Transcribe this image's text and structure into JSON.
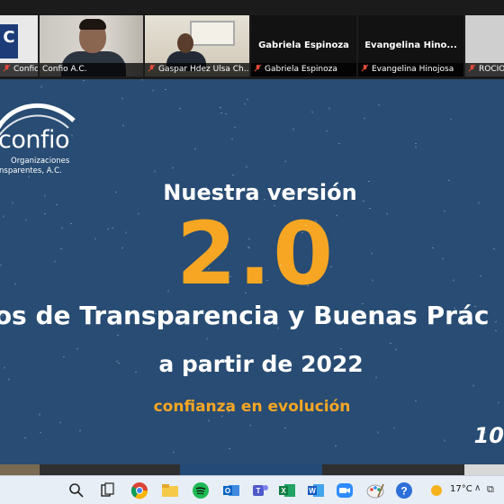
{
  "participants": [
    {
      "caption": "Confio",
      "thumb": "confio-logo"
    },
    {
      "caption": "Confio A.C.",
      "thumb": "video"
    },
    {
      "caption": "Gaspar Hdez Ulsa Ch...",
      "thumb": "video"
    },
    {
      "name": "Gabriela Espinoza",
      "caption": "Gabriela Espinoza"
    },
    {
      "name": "Evangelina  Hino...",
      "caption": "Evangelina Hinojosa"
    },
    {
      "caption": "ROCIO",
      "thumb": "grey"
    }
  ],
  "slide": {
    "logo_word": "confio",
    "logo_tag_1": "Organizaciones",
    "logo_tag_2": "nsparentes, A.C.",
    "headline": "Nuestra versión",
    "version": "2.0",
    "principles": "ipios de Transparencia y Buenas Prác",
    "subline": "a partir de 2022",
    "tagline": "confianza en evolución",
    "corner_number": "10"
  },
  "logo_mini_letter": "C",
  "taskbar": {
    "temperature": "17°C",
    "apps": [
      "search-icon",
      "task-view-icon",
      "chrome-icon",
      "file-explorer-icon",
      "spotify-icon",
      "outlook-icon",
      "teams-icon",
      "excel-icon",
      "word-icon",
      "zoom-icon",
      "paint-icon",
      "help-icon"
    ]
  },
  "colors": {
    "slide_bg": "#284c73",
    "accent": "#f6a623",
    "active_speaker": "#9ad13a",
    "muted_red": "#e04a3a"
  }
}
